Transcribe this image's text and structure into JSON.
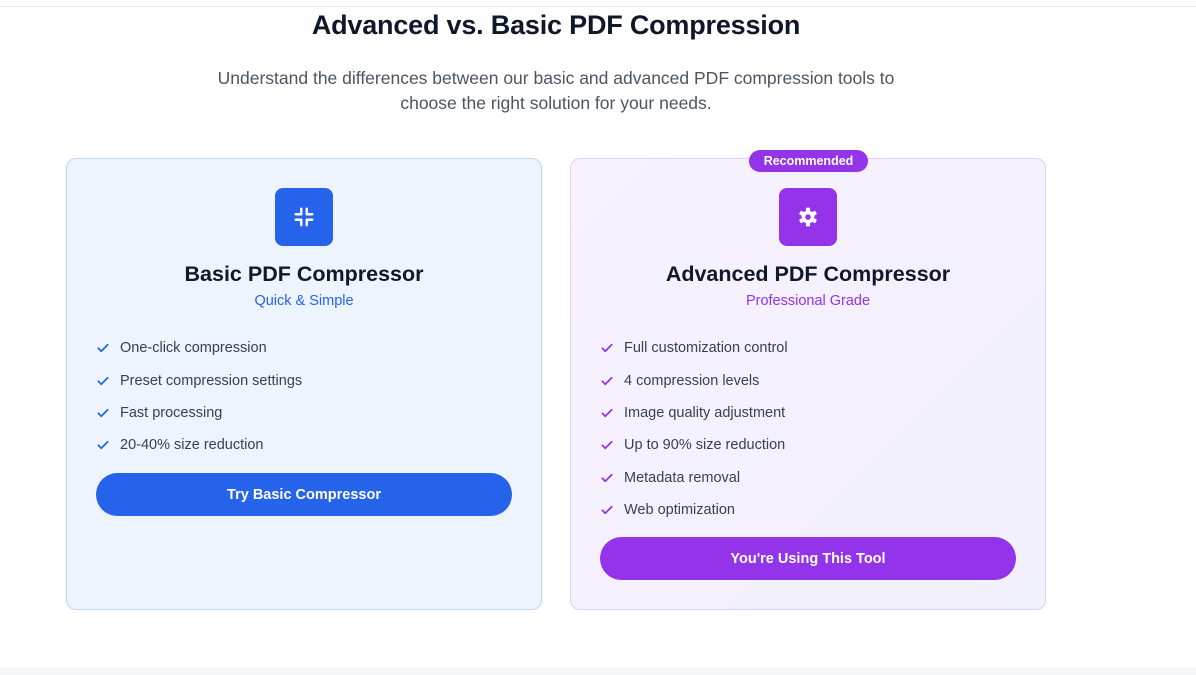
{
  "header": {
    "title": "Advanced vs. Basic PDF Compression",
    "subtitle": "Understand the differences between our basic and advanced PDF compression tools to choose the right solution for your needs."
  },
  "basic": {
    "icon": "compress-arrows-icon",
    "title": "Basic PDF Compressor",
    "tagline": "Quick & Simple",
    "accent": "#2563eb",
    "features": [
      "One-click compression",
      "Preset compression settings",
      "Fast processing",
      "20-40% size reduction"
    ],
    "cta_label": "Try Basic Compressor"
  },
  "advanced": {
    "badge": "Recommended",
    "icon": "gear-icon",
    "title": "Advanced PDF Compressor",
    "tagline": "Professional Grade",
    "accent": "#9333ea",
    "features": [
      "Full customization control",
      "4 compression levels",
      "Image quality adjustment",
      "Up to 90% size reduction",
      "Metadata removal",
      "Web optimization"
    ],
    "cta_label": "You're Using This Tool"
  }
}
